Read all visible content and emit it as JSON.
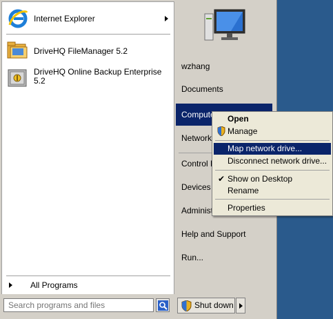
{
  "programs": [
    {
      "label": "Internet Explorer",
      "icon": "ie-icon",
      "has_submenu": true
    },
    {
      "label": "DriveHQ FileManager 5.2",
      "icon": "folder-icon"
    },
    {
      "label": "DriveHQ Online Backup Enterprise 5.2",
      "icon": "backup-safe-icon"
    }
  ],
  "all_programs": {
    "label": "All Programs"
  },
  "search": {
    "placeholder": "Search programs and files",
    "value": ""
  },
  "right_items": [
    {
      "label": "wzhang",
      "id": "user"
    },
    {
      "label": "Documents",
      "id": "documents"
    },
    {
      "label": "Computer",
      "id": "computer",
      "selected": true
    },
    {
      "label": "Network",
      "id": "network"
    },
    {
      "label": "Control Panel",
      "id": "control-panel"
    },
    {
      "label": "Devices and Printers",
      "id": "devices"
    },
    {
      "label": "Administrative Tools",
      "id": "admin-tools"
    },
    {
      "label": "Help and Support",
      "id": "help"
    },
    {
      "label": "Run...",
      "id": "run"
    }
  ],
  "shutdown": {
    "label": "Shut down"
  },
  "context_menu": {
    "items": [
      {
        "label": "Open",
        "bold": true
      },
      {
        "label": "Manage",
        "icon": "shield-icon"
      },
      {
        "label": "Map network drive...",
        "hover": true
      },
      {
        "label": "Disconnect network drive..."
      },
      {
        "label": "Show on Desktop",
        "checked": true
      },
      {
        "label": "Rename"
      },
      {
        "label": "Properties"
      }
    ]
  },
  "colors": {
    "selection": "#0a246a",
    "menu_bg": "#d4d0c8",
    "desktop": "#2a5a8c"
  }
}
